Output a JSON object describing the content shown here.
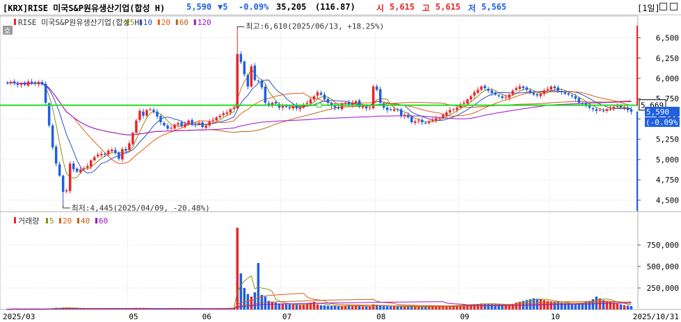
{
  "header": {
    "code": "[KRX]RISE 미국S&P원유생산기업(합성 H)",
    "price": "5,590",
    "change": "▼5",
    "change_pct": "-0.09%",
    "volume": "35,205",
    "volume_ratio": "(116.87)",
    "open_label": "시",
    "open": "5,615",
    "high_label": "고",
    "high": "5,615",
    "low_label": "저",
    "low": "5,565",
    "period_button": "[1일]",
    "restore_icon": "window-restore-icon",
    "close_icon": "window-close-icon",
    "period_icon": "hanja-icon"
  },
  "colors": {
    "up": "#e8262a",
    "down": "#1f5fe0",
    "ma5": "#8c8c16",
    "ma10": "#2a4fd0",
    "ma20": "#e85a10",
    "ma60": "#c06010",
    "ma120": "#a010c8",
    "hline": "#22dd22",
    "vol5": "#8c8c16",
    "vol20": "#e85a10",
    "vol40": "#c06010",
    "vol60": "#a010c8"
  },
  "price_legend": {
    "name": "RISE 미국S&P원유생산기업(합성 H)",
    "items": [
      "5",
      "10",
      "20",
      "60",
      "120"
    ]
  },
  "volume_legend": {
    "name": "거래량",
    "items": [
      "5",
      "20",
      "40",
      "60"
    ]
  },
  "chart_data": {
    "type": "candlestick",
    "price_axis": {
      "ylim": [
        4400,
        6650
      ],
      "ticks": [
        "6,500",
        "6,250",
        "6,000",
        "5,750",
        "5,500",
        "5,250",
        "5,000",
        "4,750",
        "4,500"
      ],
      "tick_values": [
        6500,
        6250,
        6000,
        5750,
        5500,
        5250,
        5000,
        4750,
        4500
      ]
    },
    "volume_axis": {
      "ylim": [
        0,
        1000000
      ],
      "ticks": [
        "750,000",
        "500,000",
        "250,000"
      ],
      "tick_values": [
        750000,
        500000,
        250000
      ]
    },
    "x_ticks": [
      "2025/03",
      "05",
      "06",
      "07",
      "08",
      "09",
      "10",
      "2025/10/31"
    ],
    "x_tick_index": [
      0,
      35,
      56,
      79,
      106,
      130,
      156,
      179
    ],
    "current_price": {
      "label": "5,669",
      "value": 5669
    },
    "last_price": {
      "label": "5,590",
      "value": 5590
    },
    "last_pct": "(-0.09%)",
    "max_annotation": {
      "text": "최고:6,610(2025/06/13, +18.25%)",
      "value": 6610,
      "index": 66
    },
    "min_annotation": {
      "text": "최저:4,445(2025/04/09, -20.48%)",
      "value": 4445,
      "index": 16
    },
    "closes": [
      5940,
      5955,
      5940,
      5920,
      5940,
      5920,
      5960,
      5945,
      5935,
      5955,
      5925,
      5700,
      5420,
      5150,
      4950,
      4800,
      4600,
      4620,
      4950,
      4880,
      4850,
      4880,
      4890,
      4920,
      4990,
      5030,
      5060,
      5070,
      5060,
      5110,
      5120,
      5080,
      5010,
      5130,
      5110,
      5200,
      5330,
      5480,
      5600,
      5540,
      5610,
      5620,
      5590,
      5530,
      5460,
      5420,
      5380,
      5390,
      5430,
      5450,
      5410,
      5440,
      5480,
      5440,
      5430,
      5450,
      5400,
      5420,
      5470,
      5490,
      5520,
      5540,
      5570,
      5580,
      5620,
      5640,
      6300,
      6200,
      6050,
      5900,
      6150,
      5980,
      5970,
      5890,
      5700,
      5660,
      5700,
      5690,
      5640,
      5660,
      5650,
      5630,
      5660,
      5630,
      5640,
      5680,
      5700,
      5740,
      5780,
      5830,
      5800,
      5740,
      5700,
      5660,
      5640,
      5630,
      5690,
      5700,
      5680,
      5700,
      5720,
      5650,
      5650,
      5630,
      5640,
      5900,
      5860,
      5700,
      5640,
      5610,
      5610,
      5620,
      5610,
      5540,
      5550,
      5520,
      5460,
      5470,
      5480,
      5460,
      5450,
      5470,
      5490,
      5510,
      5510,
      5550,
      5580,
      5610,
      5620,
      5640,
      5680,
      5700,
      5740,
      5780,
      5830,
      5860,
      5900,
      5880,
      5850,
      5820,
      5800,
      5780,
      5760,
      5770,
      5800,
      5850,
      5880,
      5900,
      5880,
      5860,
      5820,
      5800,
      5790,
      5810,
      5850,
      5870,
      5900,
      5880,
      5850,
      5830,
      5810,
      5800,
      5780,
      5750,
      5700,
      5690,
      5660,
      5640,
      5620,
      5600,
      5610,
      5600,
      5620,
      5640,
      5650,
      5660,
      5640,
      5640,
      5610,
      5590
    ],
    "volumes": [
      5000,
      3000,
      8000,
      6000,
      4000,
      5000,
      7000,
      4000,
      5000,
      6000,
      4000,
      9000,
      12000,
      15000,
      20000,
      18000,
      22000,
      20000,
      16000,
      14000,
      12000,
      11000,
      10000,
      9000,
      9000,
      10000,
      9000,
      8000,
      9000,
      8000,
      9000,
      10000,
      8000,
      9000,
      12000,
      14000,
      16000,
      18000,
      12000,
      10000,
      8000,
      9000,
      8000,
      7000,
      8000,
      9000,
      8000,
      7000,
      8000,
      9000,
      8000,
      7000,
      9000,
      8000,
      7000,
      8000,
      9000,
      10000,
      8000,
      9000,
      10000,
      12000,
      14000,
      15000,
      18000,
      20000,
      950000,
      420000,
      250000,
      180000,
      150000,
      200000,
      540000,
      170000,
      150000,
      100000,
      90000,
      80000,
      70000,
      65000,
      60000,
      62000,
      58000,
      55000,
      52000,
      60000,
      70000,
      80000,
      90000,
      60000,
      50000,
      48000,
      45000,
      40000,
      42000,
      40000,
      38000,
      45000,
      50000,
      46000,
      44000,
      40000,
      38000,
      36000,
      35000,
      60000,
      55000,
      45000,
      40000,
      38000,
      36000,
      35000,
      34000,
      33000,
      32000,
      31000,
      30000,
      30000,
      31000,
      32000,
      33000,
      34000,
      35000,
      36000,
      38000,
      40000,
      42000,
      45000,
      48000,
      50000,
      52000,
      55000,
      58000,
      60000,
      62000,
      65000,
      70000,
      68000,
      66000,
      64000,
      62000,
      60000,
      58000,
      56000,
      60000,
      65000,
      80000,
      90000,
      100000,
      110000,
      120000,
      130000,
      125000,
      118000,
      110000,
      100000,
      95000,
      90000,
      85000,
      80000,
      75000,
      70000,
      65000,
      60000,
      70000,
      80000,
      90000,
      100000,
      120000,
      150000,
      130000,
      110000,
      100000,
      90000,
      80000,
      70000,
      60000,
      50000,
      45000,
      40000
    ]
  }
}
